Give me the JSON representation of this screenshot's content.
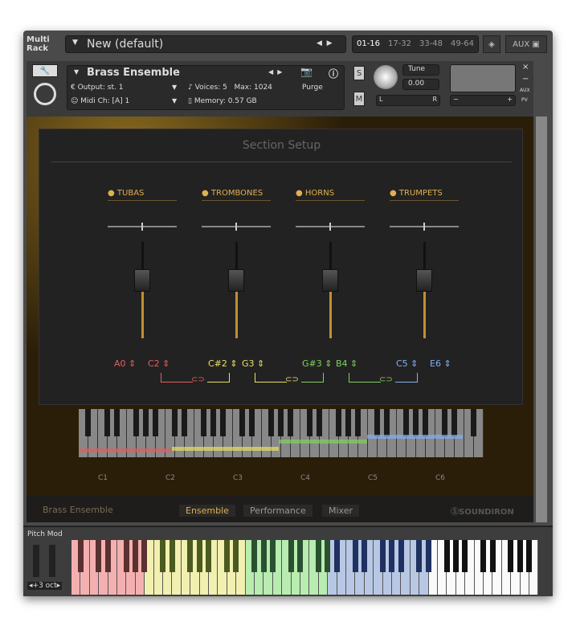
{
  "rack": {
    "label_line1": "Multi",
    "label_line2": "Rack",
    "preset": "New (default)",
    "pages": [
      "01-16",
      "17-32",
      "33-48",
      "49-64"
    ],
    "aux": "AUX"
  },
  "instrument": {
    "name": "Brass Ensemble",
    "output_label": "Output:",
    "output": "st. 1",
    "midi_label": "Midi Ch:",
    "midi": "[A] 1",
    "voices_label": "Voices:",
    "voices": "5",
    "max_label": "Max:",
    "max": "1024",
    "memory_label": "Memory:",
    "memory": "0.57 GB",
    "purge": "Purge",
    "solo": "S",
    "mute": "M",
    "tune_label": "Tune",
    "tune": "0.00",
    "pan_l": "L",
    "pan_r": "R",
    "vol_minus": "−",
    "vol_plus": "+",
    "close": "×",
    "minimize": "−",
    "aux": "AUX",
    "pv": "PV"
  },
  "section": {
    "title": "Section Setup",
    "sections": [
      {
        "name": "TUBAS",
        "low": "A0",
        "high": "C2",
        "color": "#e06060"
      },
      {
        "name": "TROMBONES",
        "low": "C#2",
        "high": "G3",
        "color": "#e8e060"
      },
      {
        "name": "HORNS",
        "low": "G#3",
        "high": "B4",
        "color": "#80d060"
      },
      {
        "name": "TRUMPETS",
        "low": "C5",
        "high": "E6",
        "color": "#80b0f0"
      }
    ]
  },
  "octave_labels": [
    "C1",
    "C2",
    "C3",
    "C4",
    "C5",
    "C6"
  ],
  "footer": {
    "instrument": "Brass Ensemble",
    "tabs": [
      "Ensemble",
      "Performance",
      "Mixer"
    ],
    "active_tab": "Ensemble",
    "brand": "SOUNDIRON"
  },
  "keyboard": {
    "pitch_mod": "Pitch Mod",
    "octave": "+3 oct"
  }
}
